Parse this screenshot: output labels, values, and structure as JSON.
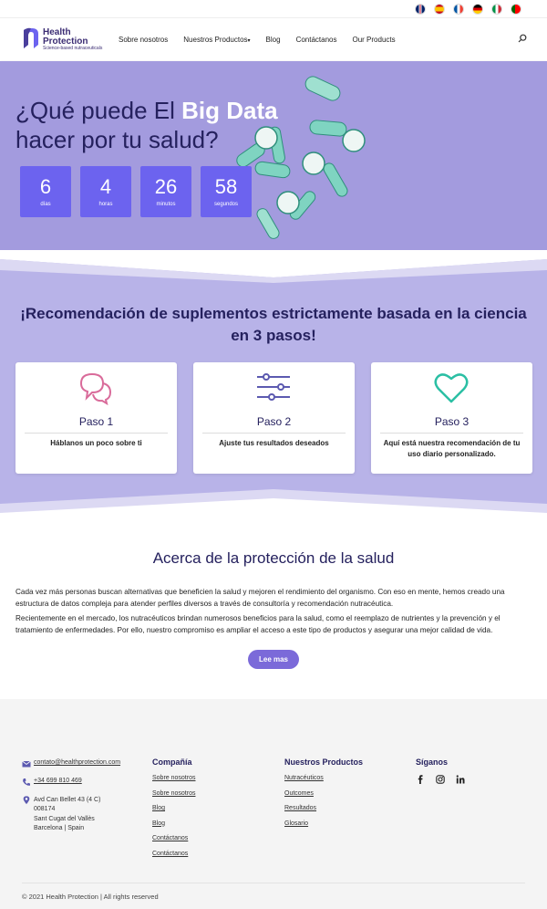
{
  "languages": [
    "en",
    "es",
    "fr",
    "de",
    "it",
    "pt"
  ],
  "brand": {
    "line1": "Health",
    "line2": "Protection",
    "tagline": "Science-based nutraceuticals"
  },
  "nav": [
    {
      "label": "Sobre nosotros"
    },
    {
      "label": "Nuestros Productos",
      "dropdown": true
    },
    {
      "label": "Blog"
    },
    {
      "label": "Contáctanos"
    },
    {
      "label": "Our Products"
    }
  ],
  "hero": {
    "title_pre": "¿Qué puede El ",
    "title_highlight": "Big Data",
    "title_post": "hacer por tu salud?",
    "countdown": [
      {
        "value": "6",
        "label": "días"
      },
      {
        "value": "4",
        "label": "horas"
      },
      {
        "value": "26",
        "label": "minutos"
      },
      {
        "value": "58",
        "label": "segundos"
      }
    ]
  },
  "steps": {
    "title": "¡Recomendación de suplementos estrictamente basada en la ciencia en 3 pasos!",
    "items": [
      {
        "title": "Paso 1",
        "desc": "Háblanos un poco sobre ti",
        "icon": "chat-bubbles-icon"
      },
      {
        "title": "Paso 2",
        "desc": "Ajuste tus resultados deseados",
        "icon": "sliders-icon"
      },
      {
        "title": "Paso 3",
        "desc": "Aquí está nuestra recomendación de tu uso diario personalizado.",
        "icon": "heart-icon"
      }
    ]
  },
  "about": {
    "title": "Acerca de la protección de la salud",
    "p1": "Cada vez más personas buscan alternativas que beneficien la salud y mejoren el rendimiento del organismo. Con eso en mente, hemos creado una estructura de datos compleja para atender perfiles diversos a través de consultoría y recomendación nutracéutica.",
    "p2": "Recientemente en el mercado, los nutracéuticos brindan numerosos beneficios para la salud, como el reemplazo de nutrientes y la prevención y el tratamiento de enfermedades. Por ello, nuestro compromiso es ampliar el acceso a este tipo de productos y asegurar una mejor calidad de vida.",
    "button": "Lee mas"
  },
  "footer": {
    "email": "contato@healthprotection.com",
    "phone": "+34 699 810 469",
    "address": [
      "Avd Can Bellet 43 (4 C)",
      "008174",
      "Sant Cugat del Vallès",
      "Barcelona | Spain"
    ],
    "company": {
      "title": "Compañía",
      "links": [
        "Sobre nosotros",
        "Sobre nosotros",
        "Blog",
        "Blog",
        "Contáctanos",
        "Contáctanos"
      ]
    },
    "products": {
      "title": "Nuestros Productos",
      "links": [
        "Nutracéuticos",
        "Outcomes",
        "Resultados",
        "Glosario"
      ]
    },
    "social": {
      "title": "Síganos",
      "icons": [
        "facebook-icon",
        "instagram-icon",
        "linkedin-icon"
      ]
    },
    "copyright": "© 2021 Health Protection | All rights reserved"
  },
  "colors": {
    "accent": "#6c63ef",
    "hero_bg": "#a39bde",
    "steps_bg": "#b8b3e8",
    "dark": "#25215e",
    "button": "#7b6ad9",
    "heart": "#2bbfa4",
    "chat": "#d96b9a"
  }
}
